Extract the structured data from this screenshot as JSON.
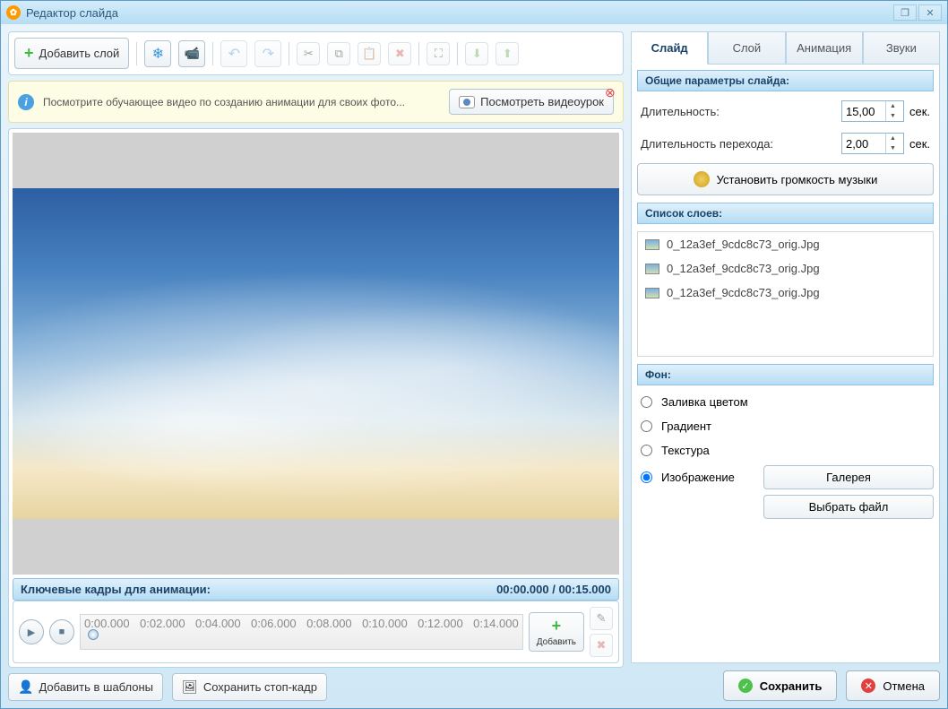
{
  "window": {
    "title": "Редактор слайда"
  },
  "toolbar": {
    "add_layer": "Добавить слой"
  },
  "banner": {
    "text": "Посмотрите обучающее видео по созданию анимации для своих фото...",
    "watch_btn": "Посмотреть видеоурок"
  },
  "keyframes": {
    "title": "Ключевые кадры для анимации:",
    "time": "00:00.000 / 00:15.000",
    "ticks": [
      "0:00.000",
      "0:02.000",
      "0:04.000",
      "0:06.000",
      "0:08.000",
      "0:10.000",
      "0:12.000",
      "0:14.000"
    ],
    "add": "Добавить"
  },
  "bottom": {
    "add_template": "Добавить в шаблоны",
    "save_frame": "Сохранить стоп-кадр"
  },
  "tabs": [
    "Слайд",
    "Слой",
    "Анимация",
    "Звуки"
  ],
  "panel": {
    "general_header": "Общие параметры слайда:",
    "duration_label": "Длительность:",
    "duration_value": "15,00",
    "sec": "сек.",
    "transition_label": "Длительность перехода:",
    "transition_value": "2,00",
    "volume_btn": "Установить громкость музыки",
    "layers_header": "Список слоев:",
    "layers": [
      "0_12a3ef_9cdc8c73_orig.Jpg",
      "0_12a3ef_9cdc8c73_orig.Jpg",
      "0_12a3ef_9cdc8c73_orig.Jpg"
    ],
    "bg_header": "Фон:",
    "bg_options": {
      "fill": "Заливка цветом",
      "gradient": "Градиент",
      "texture": "Текстура",
      "image": "Изображение"
    },
    "gallery": "Галерея",
    "choose_file": "Выбрать файл"
  },
  "footer": {
    "save": "Сохранить",
    "cancel": "Отмена"
  }
}
